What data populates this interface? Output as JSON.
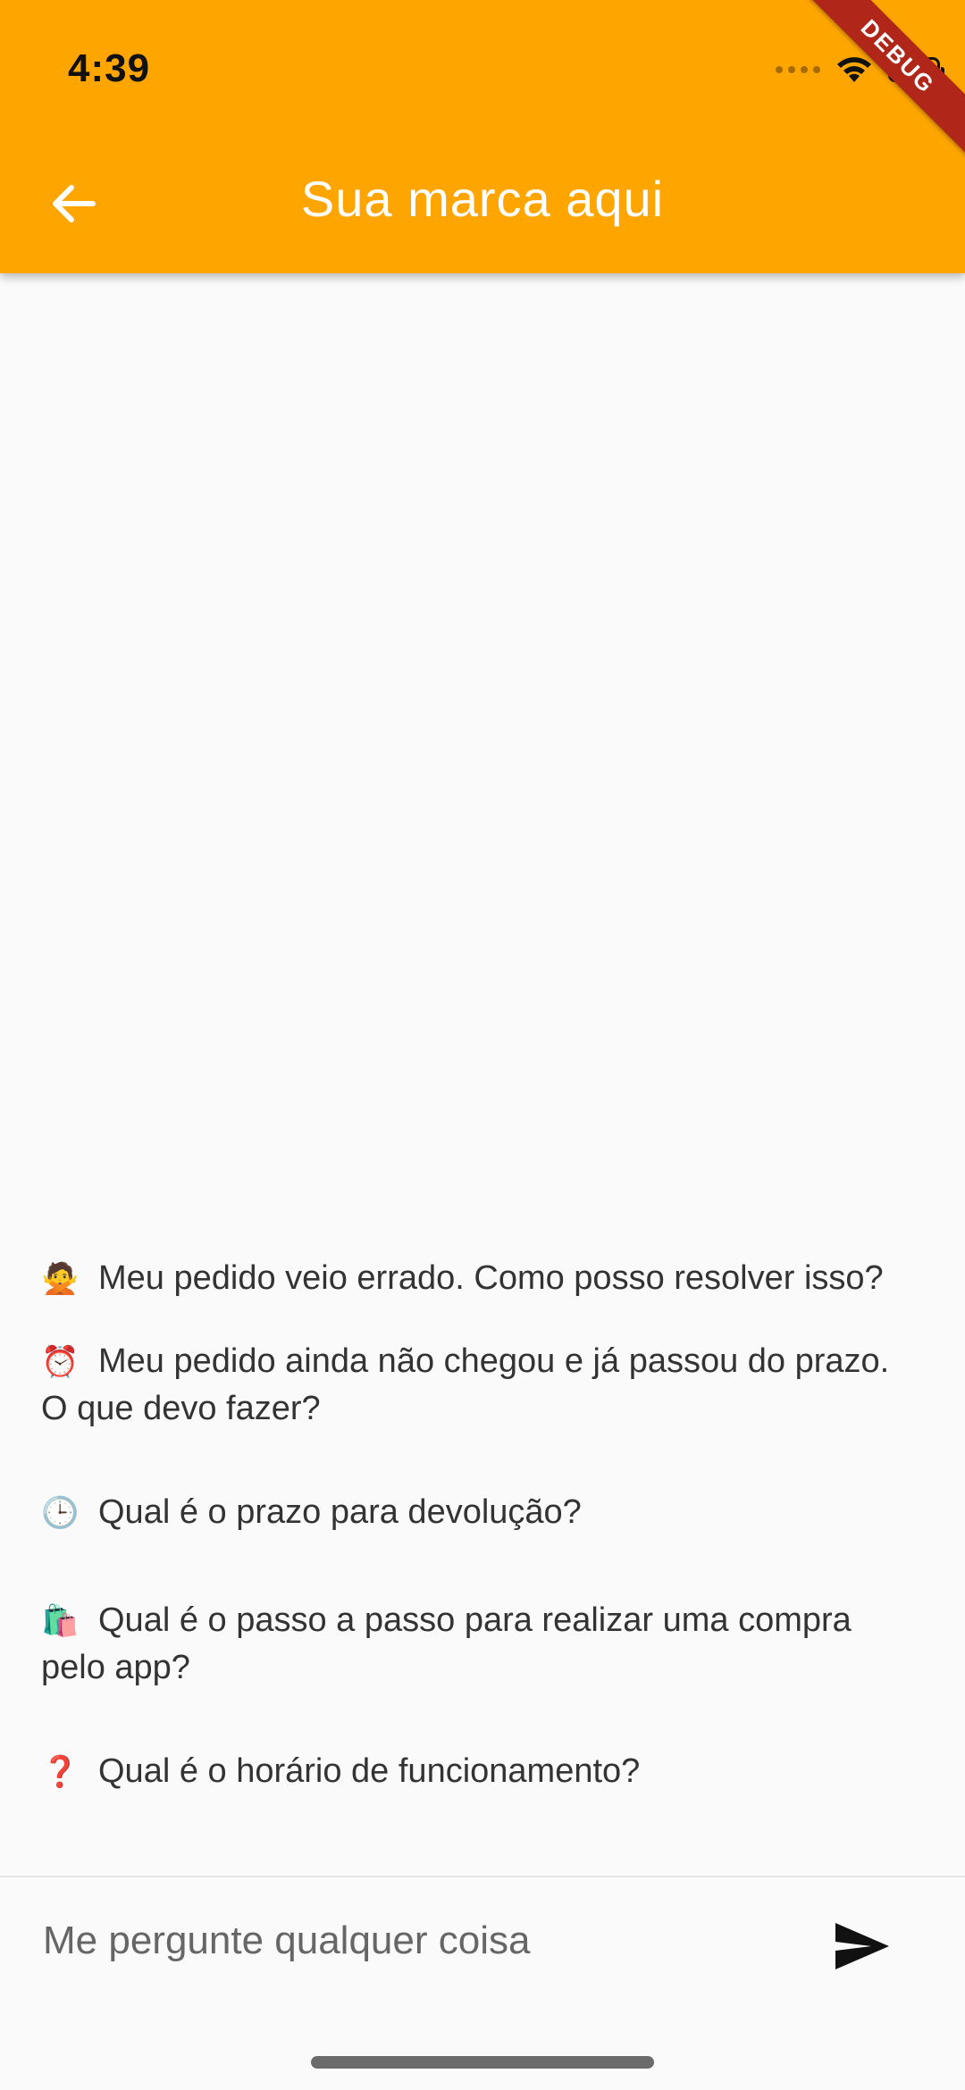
{
  "status_bar": {
    "time": "4:39"
  },
  "debug_banner": "DEBUG",
  "appbar": {
    "title": "Sua marca aqui"
  },
  "suggestions": [
    {
      "emoji": "🙅",
      "text": "Meu pedido veio errado. Como posso resolver isso?"
    },
    {
      "emoji": "⏰",
      "text": "Meu pedido ainda não chegou e já passou do prazo. O que devo fazer?"
    },
    {
      "emoji": "🕒",
      "text": "Qual é o prazo para devolução?"
    },
    {
      "emoji": "🛍️",
      "text": "Qual é o passo a passo para realizar uma compra pelo app?"
    },
    {
      "emoji": "❓",
      "text": "Qual é o horário de funcionamento?"
    }
  ],
  "input": {
    "placeholder": "Me pergunte qualquer coisa",
    "value": ""
  },
  "colors": {
    "appbar": "#ffa500",
    "background": "#fafafa",
    "ribbon": "#b0271a"
  }
}
